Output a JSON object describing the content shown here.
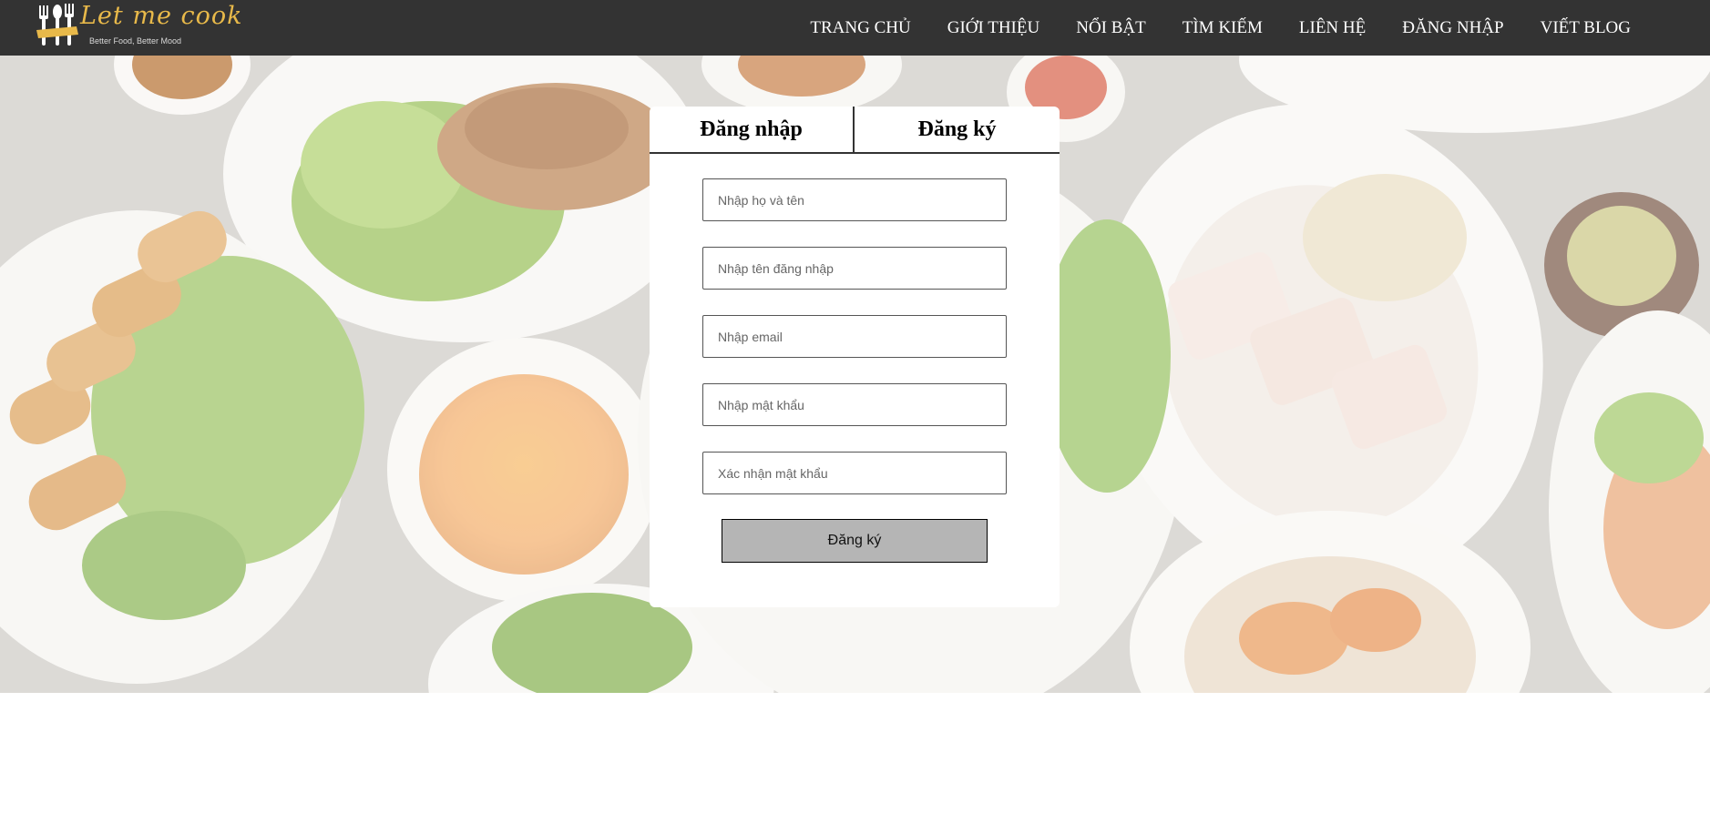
{
  "brand": {
    "name": "Let me cook",
    "tagline": "Better Food, Better Mood"
  },
  "nav": {
    "items": [
      {
        "label": "TRANG CHỦ"
      },
      {
        "label": "GIỚI THIỆU"
      },
      {
        "label": "NỔI BẬT"
      },
      {
        "label": "TÌM KIẾM"
      },
      {
        "label": "LIÊN HỆ"
      },
      {
        "label": "ĐĂNG NHẬP"
      },
      {
        "label": "VIẾT BLOG"
      }
    ]
  },
  "auth": {
    "tabs": [
      {
        "label": "Đăng nhập"
      },
      {
        "label": "Đăng ký"
      }
    ],
    "fields": {
      "fullname": {
        "placeholder": "Nhập họ và tên",
        "value": ""
      },
      "username": {
        "placeholder": "Nhập tên đăng nhập",
        "value": ""
      },
      "email": {
        "placeholder": "Nhập email",
        "value": ""
      },
      "password": {
        "placeholder": "Nhập mật khẩu",
        "value": ""
      },
      "confirm_password": {
        "placeholder": "Xác nhận mật khẩu",
        "value": ""
      }
    },
    "submit_label": "Đăng ký"
  },
  "colors": {
    "navbar_bg": "#333333",
    "brand_accent": "#e8b94a",
    "submit_bg": "#b5b5b5",
    "card_bg": "#ffffff"
  }
}
